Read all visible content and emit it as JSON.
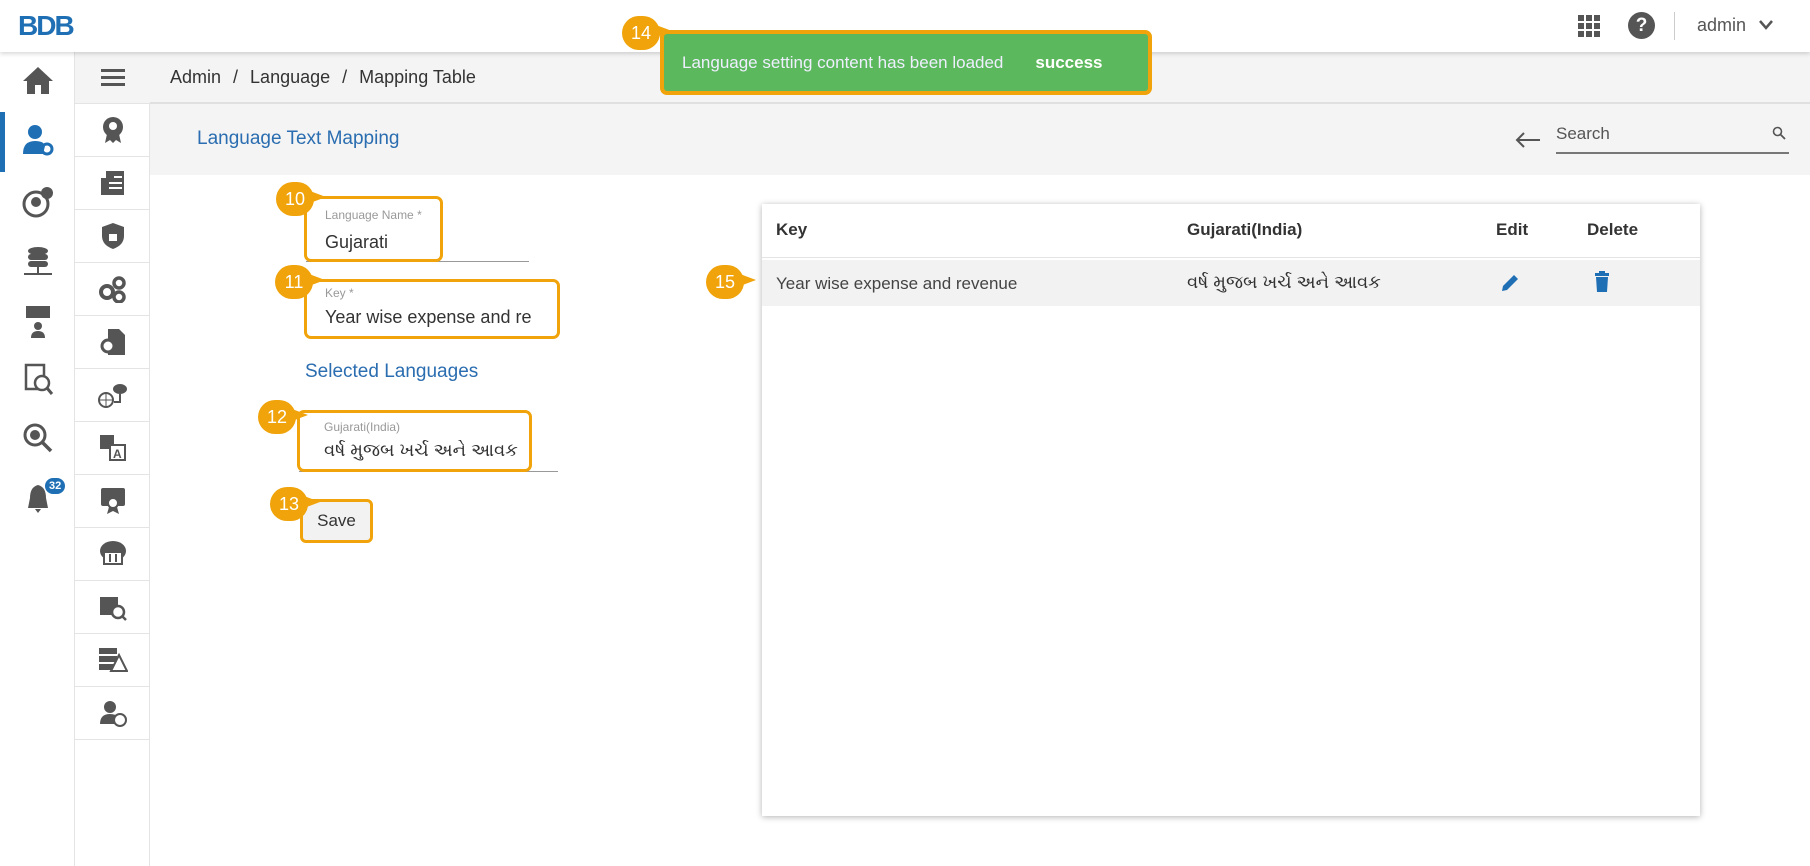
{
  "header": {
    "logo_text": "BDB",
    "user": "admin"
  },
  "breadcrumb": [
    "Admin",
    "Language",
    "Mapping Table"
  ],
  "breadcrumb_sep": "/",
  "page_title": "Language Text Mapping",
  "search": {
    "placeholder": "Search"
  },
  "form": {
    "language_name_label": "Language Name *",
    "language_name_value": "Gujarati",
    "key_label": "Key *",
    "key_value": "Year wise expense and re",
    "selected_languages_heading": "Selected Languages",
    "gujarati_label": "Gujarati(India)",
    "gujarati_value": "વર્ષ મુજબ ખર્ચ અને આવક",
    "save_label": "Save"
  },
  "table": {
    "headers": [
      "Key",
      "Gujarati(India)",
      "Edit",
      "Delete"
    ],
    "rows": [
      {
        "key": "Year wise expense and revenue",
        "gujarati": "વર્ષ મુજબ ખર્ચ અને આવક"
      }
    ]
  },
  "toast": {
    "message": "Language setting content has been loaded",
    "status": "success"
  },
  "notifications_count": "32",
  "annotations": [
    "10",
    "11",
    "12",
    "13",
    "14",
    "15"
  ],
  "colors": {
    "accent": "#2a6db0",
    "toast": "#5cb85c",
    "annotation": "#f0a30a"
  }
}
